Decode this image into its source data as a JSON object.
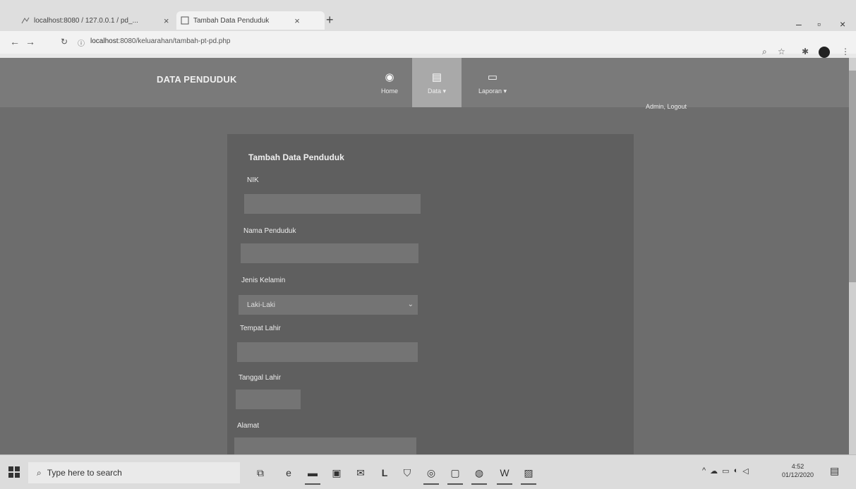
{
  "browser": {
    "tabs": [
      {
        "title": "localhost:8080 / 127.0.0.1 / pd_..."
      },
      {
        "title": "Tambah Data Penduduk"
      }
    ],
    "url_host": "localhost",
    "url_path": ":8080/keluarahan/tambah-pt-pd.php"
  },
  "navbar": {
    "brand": "DATA PENDUDUK",
    "items": [
      {
        "label": "Home",
        "icon": "dashboard-icon"
      },
      {
        "label": "Data",
        "icon": "file-icon",
        "active": true
      },
      {
        "label": "Laporan",
        "icon": "monitor-icon"
      }
    ],
    "admin": "Admin, Logout"
  },
  "form": {
    "title": "Tambah Data Penduduk",
    "fields": [
      {
        "label": "NIK",
        "value": ""
      },
      {
        "label": "Nama Penduduk",
        "value": ""
      },
      {
        "label": "Jenis Kelamin",
        "value": "Laki-Laki"
      },
      {
        "label": "Tempat Lahir",
        "value": ""
      },
      {
        "label": "Tanggal Lahir",
        "value": ""
      },
      {
        "label": "Alamat",
        "value": ""
      }
    ]
  },
  "taskbar": {
    "search_placeholder": "Type here to search",
    "time": "4:52",
    "date": "01/12/2020"
  }
}
